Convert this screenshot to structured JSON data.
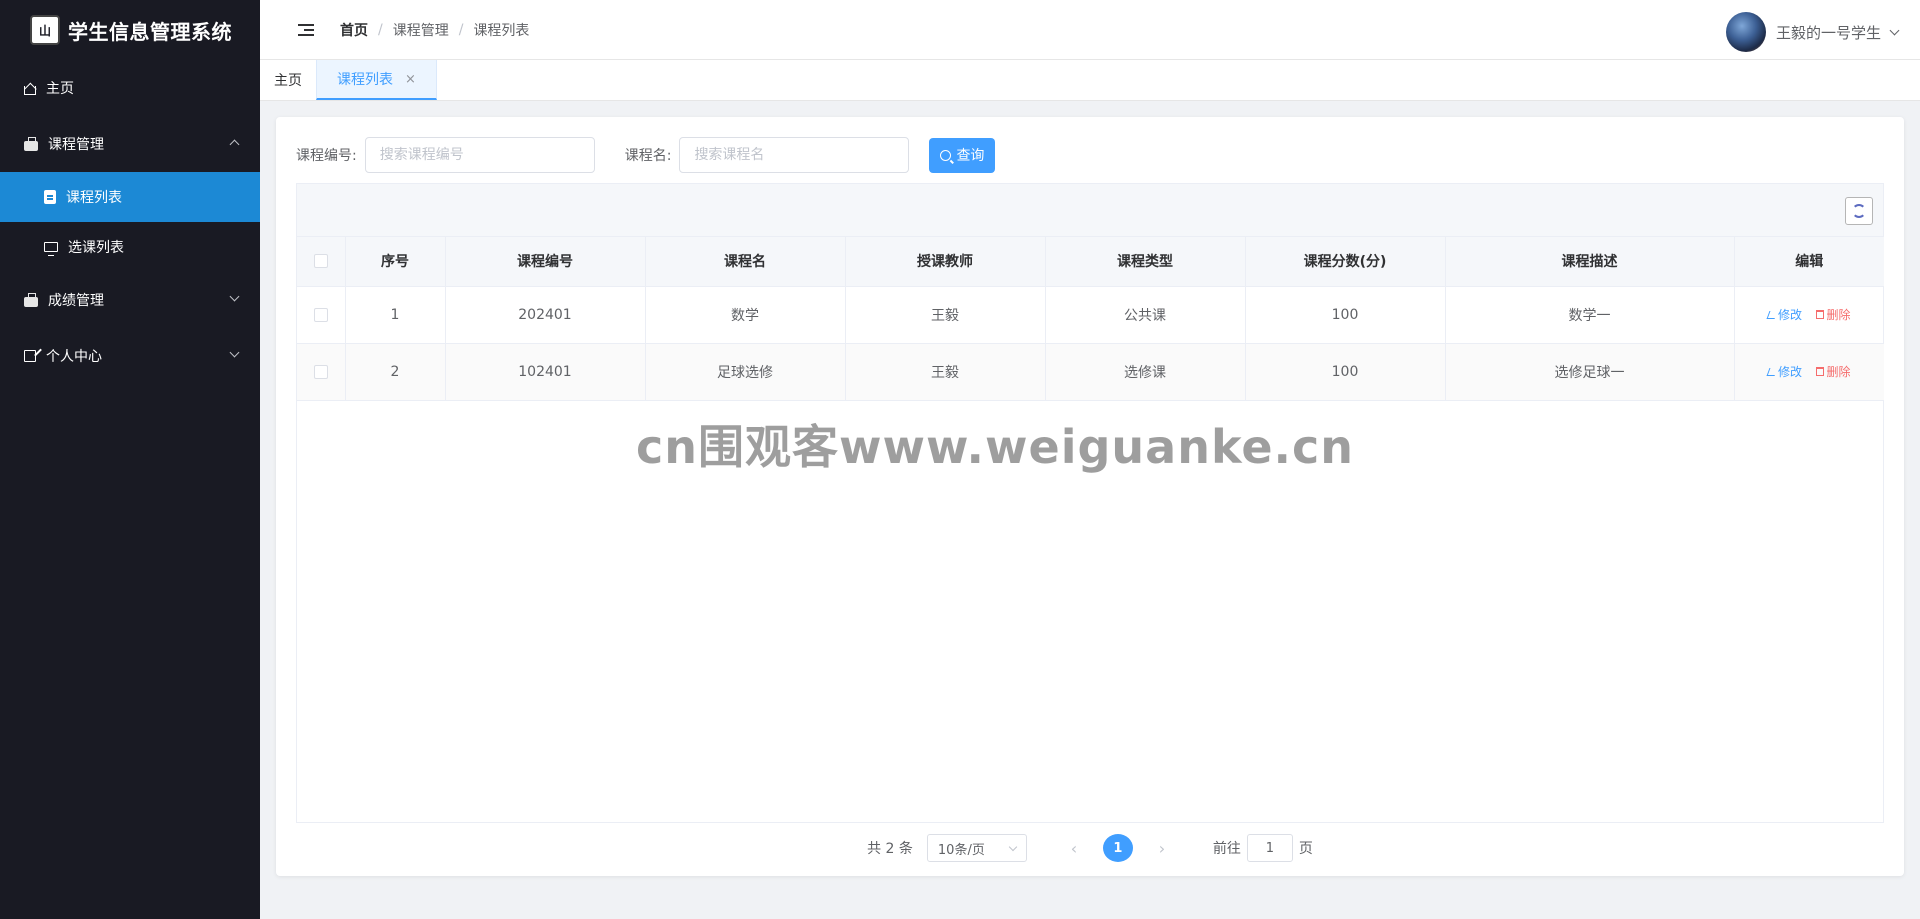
{
  "app": {
    "title": "学生信息管理系统",
    "logo_text": "山"
  },
  "sidebar": {
    "items": [
      {
        "label": "主页"
      },
      {
        "label": "课程管理",
        "children": [
          {
            "label": "课程列表"
          },
          {
            "label": "选课列表"
          }
        ]
      },
      {
        "label": "成绩管理"
      },
      {
        "label": "个人中心"
      }
    ]
  },
  "header": {
    "breadcrumb": [
      "首页",
      "课程管理",
      "课程列表"
    ],
    "sep": "/",
    "user_name": "王毅的一号学生"
  },
  "tabs": [
    {
      "label": "主页"
    },
    {
      "label": "课程列表",
      "close": "×"
    }
  ],
  "search": {
    "code_label": "课程编号:",
    "code_placeholder": "搜索课程编号",
    "name_label": "课程名:",
    "name_placeholder": "搜索课程名",
    "query_label": "查询"
  },
  "table": {
    "columns": [
      "序号",
      "课程编号",
      "课程名",
      "授课教师",
      "课程类型",
      "课程分数(分)",
      "课程描述",
      "编辑"
    ],
    "rows": [
      {
        "idx": "1",
        "code": "202401",
        "name": "数学",
        "teacher": "王毅",
        "type": "公共课",
        "score": "100",
        "desc": "数学一"
      },
      {
        "idx": "2",
        "code": "102401",
        "name": "足球选修",
        "teacher": "王毅",
        "type": "选修课",
        "score": "100",
        "desc": "选修足球一"
      }
    ],
    "edit_label": "修改",
    "delete_label": "删除"
  },
  "watermark": "cn围观客www.weiguanke.cn",
  "pagination": {
    "total": "共 2 条",
    "page_size": "10条/页",
    "prev": "‹",
    "next": "›",
    "current": "1",
    "goto_label": "前往",
    "goto_value": "1",
    "page_unit": "页"
  },
  "colors": {
    "sidebar_bg": "#191a23",
    "active_menu": "#1c89d5",
    "primary": "#409eff",
    "danger": "#f56c6c"
  }
}
